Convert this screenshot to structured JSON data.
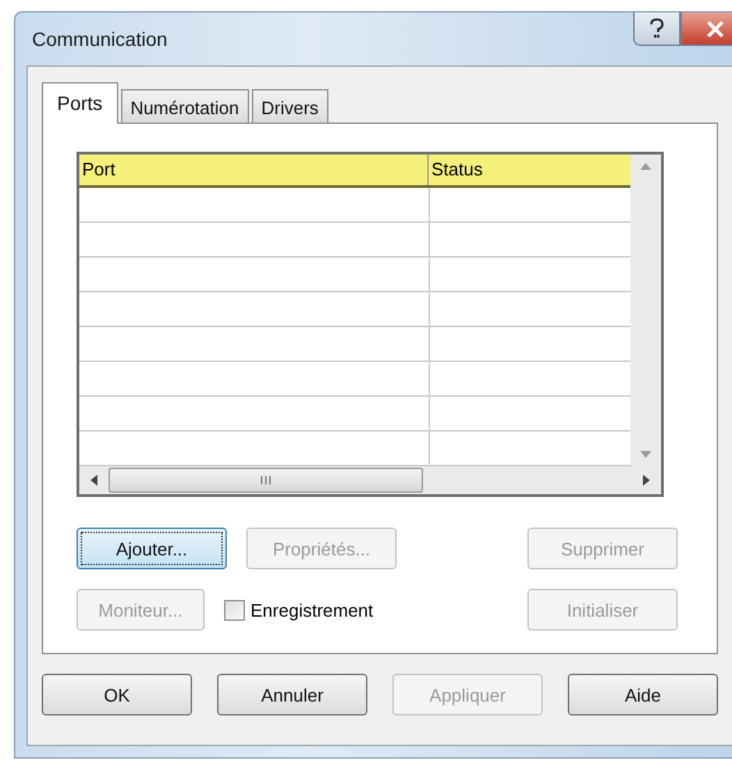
{
  "window": {
    "title": "Communication"
  },
  "tabs": [
    {
      "label": "Ports",
      "selected": true
    },
    {
      "label": "Numérotation",
      "selected": false
    },
    {
      "label": "Drivers",
      "selected": false
    }
  ],
  "table": {
    "columns": [
      "Port",
      "Status"
    ]
  },
  "actions_row_1": [
    {
      "label": "Ajouter...",
      "disabled": false,
      "focused": true
    },
    {
      "label": "Propriétés...",
      "disabled": true,
      "focused": false
    },
    {
      "label": "Supprimer",
      "disabled": true,
      "focused": false
    }
  ],
  "actions_row_2": [
    {
      "label": "Moniteur...",
      "disabled": true,
      "focused": false
    },
    {
      "label": "Initialiser",
      "disabled": true,
      "focused": false
    }
  ],
  "recording_checkbox": {
    "label": "Enregistrement",
    "checked": false
  },
  "dialog_buttons": [
    {
      "label": "OK",
      "disabled": false
    },
    {
      "label": "Annuler",
      "disabled": false
    },
    {
      "label": "Appliquer",
      "disabled": true
    },
    {
      "label": "Aide",
      "disabled": false
    }
  ]
}
